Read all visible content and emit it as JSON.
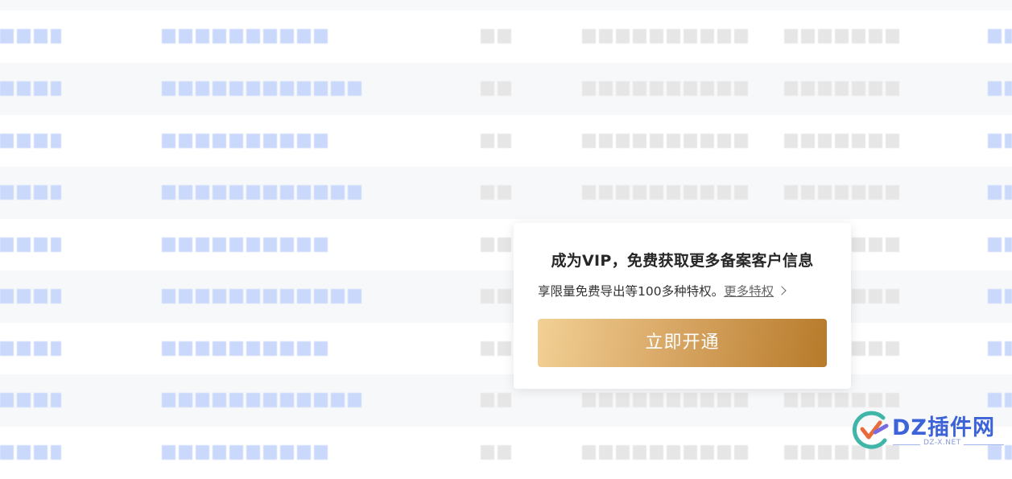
{
  "rows": [
    {
      "id": 1
    },
    {
      "id": 2
    },
    {
      "id": 3
    },
    {
      "id": 4
    },
    {
      "id": 5
    },
    {
      "id": 6
    },
    {
      "id": 7
    },
    {
      "id": 8
    },
    {
      "id": 9
    }
  ],
  "vip_popup": {
    "title": "成为VIP，免费获取更多备案客户信息",
    "description": "享限量免费导出等100多种特权。",
    "more_link": "更多特权",
    "cta_button": "立即开通"
  },
  "watermark": {
    "title": "DZ插件网",
    "subtitle": "DZ-X.NET"
  },
  "colors": {
    "blurred_link": "#c9d8fb",
    "blurred_text": "#e6e6e6",
    "row_alt": "#f7f8fa",
    "cta_gradient_start": "#f2d095",
    "cta_gradient_end": "#b77a2a",
    "watermark_brand": "#3d63d8"
  }
}
